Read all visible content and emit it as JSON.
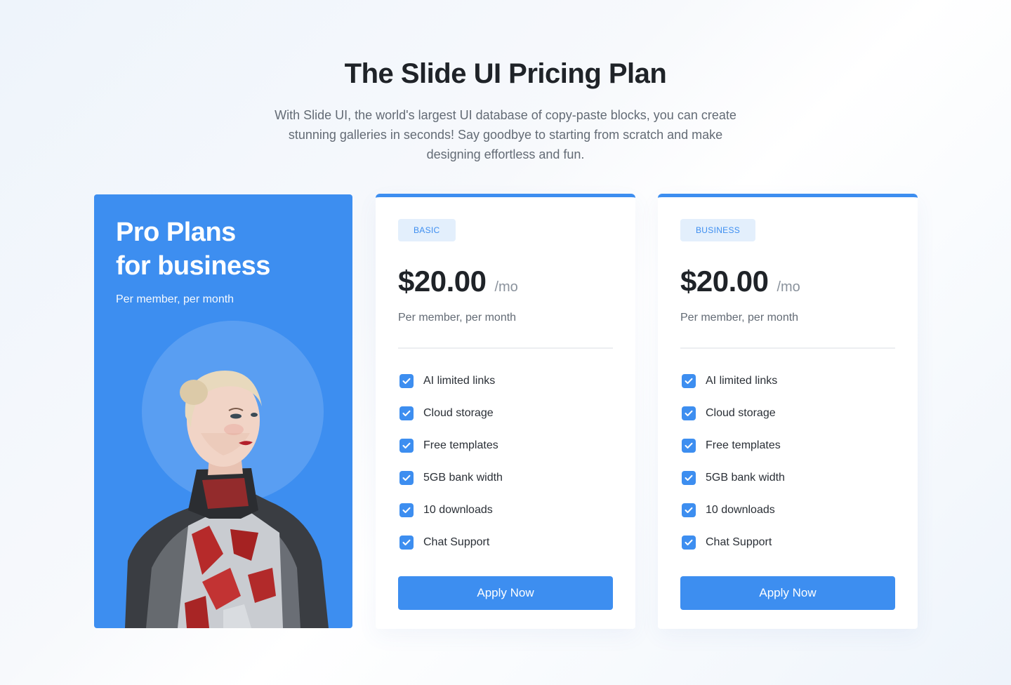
{
  "header": {
    "title": "The Slide UI Pricing Plan",
    "subtitle": "With Slide UI, the world's largest UI database of copy-paste blocks, you can create stunning galleries in seconds! Say goodbye to starting from scratch and make designing effortless and fun."
  },
  "promo": {
    "title_line1": "Pro Plans",
    "title_line2": "for business",
    "subtitle": "Per member, per month"
  },
  "plans": [
    {
      "badge": "BASIC",
      "price": "$20.00",
      "period": "/mo",
      "note": "Per member, per month",
      "features": [
        "AI limited links",
        "Cloud storage",
        "Free templates",
        "5GB bank width",
        "10 downloads",
        "Chat Support"
      ],
      "button": "Apply Now"
    },
    {
      "badge": "BUSINESS",
      "price": "$20.00",
      "period": "/mo",
      "note": "Per member, per month",
      "features": [
        "AI limited links",
        "Cloud storage",
        "Free templates",
        "5GB bank width",
        "10 downloads",
        "Chat Support"
      ],
      "button": "Apply Now"
    }
  ],
  "colors": {
    "accent": "#3d8ef0",
    "badge_bg": "#e3effc",
    "title": "#1f2328",
    "muted": "#636b75"
  },
  "icons": {
    "feature_check": "checkbox-checked-icon"
  }
}
